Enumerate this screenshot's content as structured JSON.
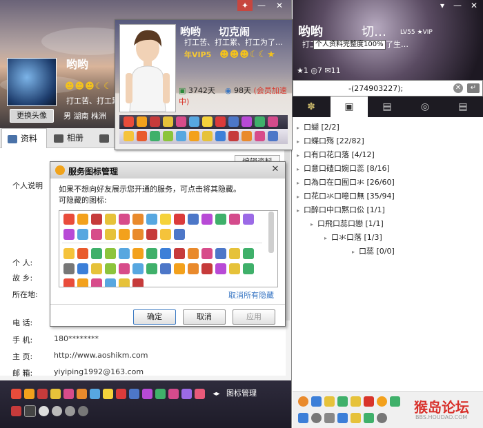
{
  "left_window": {
    "name": "哟哟",
    "slogan": "打工苦、打工累",
    "location": "男  湖南 株洲",
    "change_avatar": "更换头像",
    "tabs": [
      "资料",
      "相册",
      "三"
    ],
    "edit_button": "编辑资料",
    "section_personal": "个人说明",
    "fields": [
      {
        "label": "个    人:",
        "value": ""
      },
      {
        "label": "故    乡:",
        "value": ""
      },
      {
        "label": "所在地:",
        "value": ""
      },
      {
        "label": "电    话:",
        "value": ""
      },
      {
        "label": "手    机:",
        "value": "180********"
      },
      {
        "label": "主    页:",
        "value": "http://www.aoshikm.com"
      },
      {
        "label": "邮    箱:",
        "value": "yiyiping1992@163.com"
      }
    ],
    "icon_manage": "图标管理"
  },
  "profile_card": {
    "name": "哟哟",
    "name2": "切克闹",
    "signature": "打工苦、打工累、打工为了…",
    "vip": "年VIP5",
    "stat_likes": "3742天",
    "stat_speed_days": "98天",
    "stat_speed_label": "(会员加速中)"
  },
  "dialog": {
    "title": "服务图标管理",
    "desc_line1": "如果不想向好友展示您开通的服务，可点击将其隐藏。",
    "desc_line2": "可隐藏的图标:",
    "unhide_all": "取消所有隐藏",
    "confirm": "确定",
    "cancel": "取消",
    "apply": "应用"
  },
  "right_panel": {
    "name": "哟哟",
    "name2": "切…",
    "signature": "打工苦、打工累、打工为了生…",
    "tooltip": "个人资料完整度100%",
    "badges": "LV55  ★VIP",
    "status_counts": "★1  ◎7  ✉11",
    "search_text": "-(274903227);",
    "search_clear": "✕",
    "search_go": "↵",
    "tabs": [
      "✽",
      "▣",
      "▤",
      "◎",
      "▤"
    ],
    "groups": [
      {
        "name": "口蝴",
        "count": "[2/2]"
      },
      {
        "name": "口蝶口殇",
        "count": "[22/82]"
      },
      {
        "name": "口有口花口落",
        "count": "[4/12]"
      },
      {
        "name": "口意口碴口婉口蕊",
        "count": "[8/16]"
      },
      {
        "name": "口為口在口囿口氺",
        "count": "[26/60]"
      },
      {
        "name": "口花口氺口噫口無",
        "count": "[35/94]"
      },
      {
        "name": "口醉口中口黙口伀",
        "count": "[1/1]"
      },
      {
        "name": "口飛口蕊口戀",
        "count": "[1/1]"
      },
      {
        "name": "口氺口落",
        "count": "[1/3]"
      },
      {
        "name": "口蕊",
        "count": "[0/0]"
      }
    ],
    "logo": "猴岛论坛",
    "logo_sub": "BBS.HOUDAO.COM"
  },
  "colors": {
    "accent_blue": "#3a77c4",
    "speed_red": "#d8342a",
    "vip_gold": "#f6c833"
  }
}
